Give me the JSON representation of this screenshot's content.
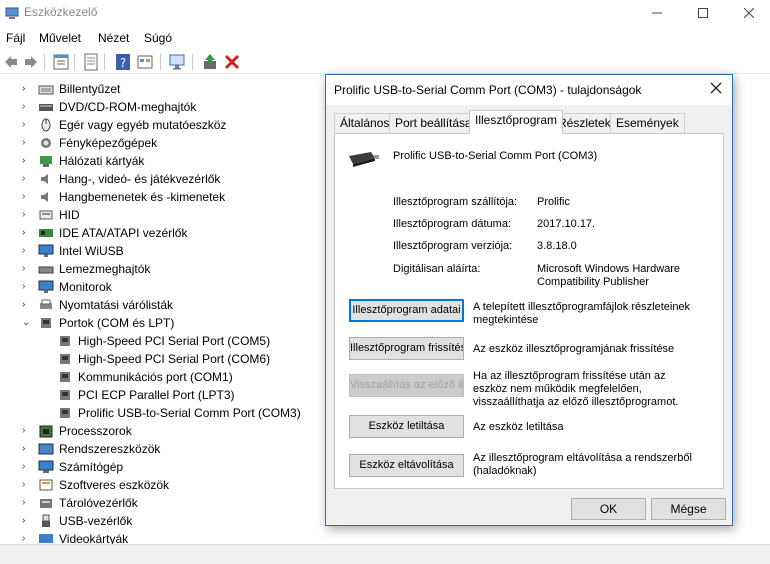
{
  "window": {
    "title": "Eszközkezelő"
  },
  "menu": [
    "Fájl",
    "Művelet",
    "Nézet",
    "Súgó"
  ],
  "tree": {
    "categories": [
      {
        "label": "Billentyűzet",
        "icon": "keyboard-icon"
      },
      {
        "label": "DVD/CD-ROM-meghajtók",
        "icon": "disc-drive-icon"
      },
      {
        "label": "Egér vagy egyéb mutatóeszköz",
        "icon": "mouse-icon"
      },
      {
        "label": "Fényképezőgépek",
        "icon": "camera-icon"
      },
      {
        "label": "Hálózati kártyák",
        "icon": "network-icon"
      },
      {
        "label": "Hang-, videó- és játékvezérlők",
        "icon": "speaker-icon"
      },
      {
        "label": "Hangbemenetek és -kimenetek",
        "icon": "speaker-icon"
      },
      {
        "label": "HID",
        "icon": "hid-icon"
      },
      {
        "label": "IDE ATA/ATAPI vezérlők",
        "icon": "controller-icon"
      },
      {
        "label": "Intel WiUSB",
        "icon": "monitor-icon"
      },
      {
        "label": "Lemezmeghajtók",
        "icon": "disk-icon"
      },
      {
        "label": "Monitorok",
        "icon": "monitor-icon"
      },
      {
        "label": "Nyomtatási várólisták",
        "icon": "printer-icon"
      },
      {
        "label": "Portok (COM és LPT)",
        "icon": "port-icon"
      }
    ],
    "ports": [
      "High-Speed PCI Serial Port (COM5)",
      "High-Speed PCI Serial Port (COM6)",
      "Kommunikációs port (COM1)",
      "PCI ECP Parallel Port (LPT3)",
      "Prolific USB-to-Serial Comm Port (COM3)"
    ],
    "categories_after": [
      {
        "label": "Processzorok",
        "icon": "cpu-icon"
      },
      {
        "label": "Rendszereszközök",
        "icon": "system-icon"
      },
      {
        "label": "Számítógép",
        "icon": "computer-icon"
      },
      {
        "label": "Szoftveres eszközök",
        "icon": "software-icon"
      },
      {
        "label": "Tárolóvezérlők",
        "icon": "storage-icon"
      },
      {
        "label": "USB-vezérlők",
        "icon": "usb-icon"
      },
      {
        "label": "Videokártyák",
        "icon": "display-adapter-icon"
      }
    ]
  },
  "dialog": {
    "title": "Prolific USB-to-Serial Comm Port (COM3) - tulajdonságok",
    "tabs": [
      "Általános",
      "Port beállítása",
      "Illesztőprogram",
      "Részletek",
      "Események"
    ],
    "active_tab": "Illesztőprogram",
    "device_name": "Prolific USB-to-Serial Comm Port (COM3)",
    "props": [
      {
        "label": "Illesztőprogram szállítója:",
        "value": "Prolific"
      },
      {
        "label": "Illesztőprogram dátuma:",
        "value": "2017.10.17."
      },
      {
        "label": "Illesztőprogram verziója:",
        "value": "3.8.18.0"
      },
      {
        "label": "Digitálisan aláírta:",
        "value": "Microsoft Windows Hardware Compatibility Publisher"
      }
    ],
    "actions": [
      {
        "button": "Illesztőprogram adatai",
        "desc": "A telepített illesztőprogramfájlok részleteinek megtekintése"
      },
      {
        "button": "Illesztőprogram frissítése",
        "desc": "Az eszköz illesztőprogramjának frissítése"
      },
      {
        "button": "Visszaállítás az előző illesztőprogramra",
        "desc": "Ha az illesztőprogram frissítése után az eszköz nem működik megfelelően, visszaállíthatja az előző illesztőprogramot."
      },
      {
        "button": "Eszköz letiltása",
        "desc": "Az eszköz letiltása"
      },
      {
        "button": "Eszköz eltávolítása",
        "desc": "Az illesztőprogram eltávolítása a rendszerből (haladóknak)"
      }
    ],
    "ok": "OK",
    "cancel": "Mégse"
  }
}
